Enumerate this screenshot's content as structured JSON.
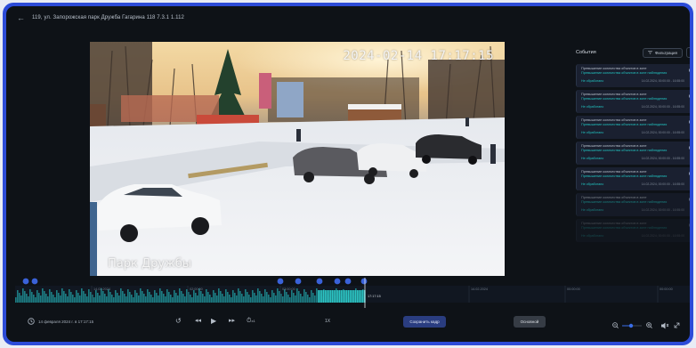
{
  "header": {
    "back_icon": "arrow-left-icon",
    "title": "119, ул. Запорожская парк Дружба Гагарина 118 7.3.1 1.112"
  },
  "video": {
    "timestamp": "2024-02-14 17:17:15",
    "watermark": "Парк Дружбы"
  },
  "events_panel": {
    "title": "События",
    "filter_label": "Фильтрация",
    "filter_icon": "filter-icon",
    "collapse_icon": "chevron-right-icon",
    "items": [
      {
        "line1": "Превышение количества объектов в зоне",
        "line2": "Превышение количества объектов в зоне наблюдения",
        "status": "Не обработано",
        "time": "14.02.2024, 00:00:00 - 16:55:00"
      },
      {
        "line1": "Превышение количества объектов в зоне",
        "line2": "Превышение количества объектов в зоне наблюдения",
        "status": "Не обработано",
        "time": "14.02.2024, 00:00:00 - 16:55:00"
      },
      {
        "line1": "Превышение количества объектов в зоне",
        "line2": "Превышение количества объектов в зоне наблюдения",
        "status": "Не обработано",
        "time": "14.02.2024, 00:00:00 - 16:55:00"
      },
      {
        "line1": "Превышение количества объектов в зоне",
        "line2": "Превышение количества объектов в зоне наблюдения",
        "status": "Не обработано",
        "time": "14.02.2024, 00:00:00 - 16:55:00"
      },
      {
        "line1": "Превышение количества объектов в зоне",
        "line2": "Превышение количества объектов в зоне наблюдения",
        "status": "Не обработано",
        "time": "14.02.2024, 00:00:00 - 16:55:00"
      },
      {
        "line1": "Превышение количества объектов в зоне",
        "line2": "Превышение количества объектов в зоне наблюдения",
        "status": "Не обработано",
        "time": "14.02.2024, 00:00:00 - 16:55:00"
      },
      {
        "line1": "Превышение количества объектов в зоне",
        "line2": "Превышение количества объектов в зоне наблюдения",
        "status": "Не обработано",
        "time": "14.02.2024, 00:00:00 - 16:55:00"
      }
    ]
  },
  "timeline": {
    "labels": [
      "14.02.2024",
      "02:00:00",
      "03:00:00",
      "14.02.2024",
      "00:00:00",
      "00:00:00"
    ],
    "current_label": "17:17:15"
  },
  "controls": {
    "date": "14 февраля 2024 г. в 17:17:15",
    "speed": "x1",
    "ratio": "1X",
    "save_frame": "Сохранить кадр",
    "main_stream": "Основной"
  },
  "colors": {
    "accent": "#2c4bd8",
    "teal": "#22c3c0",
    "background": "#0e1217"
  }
}
